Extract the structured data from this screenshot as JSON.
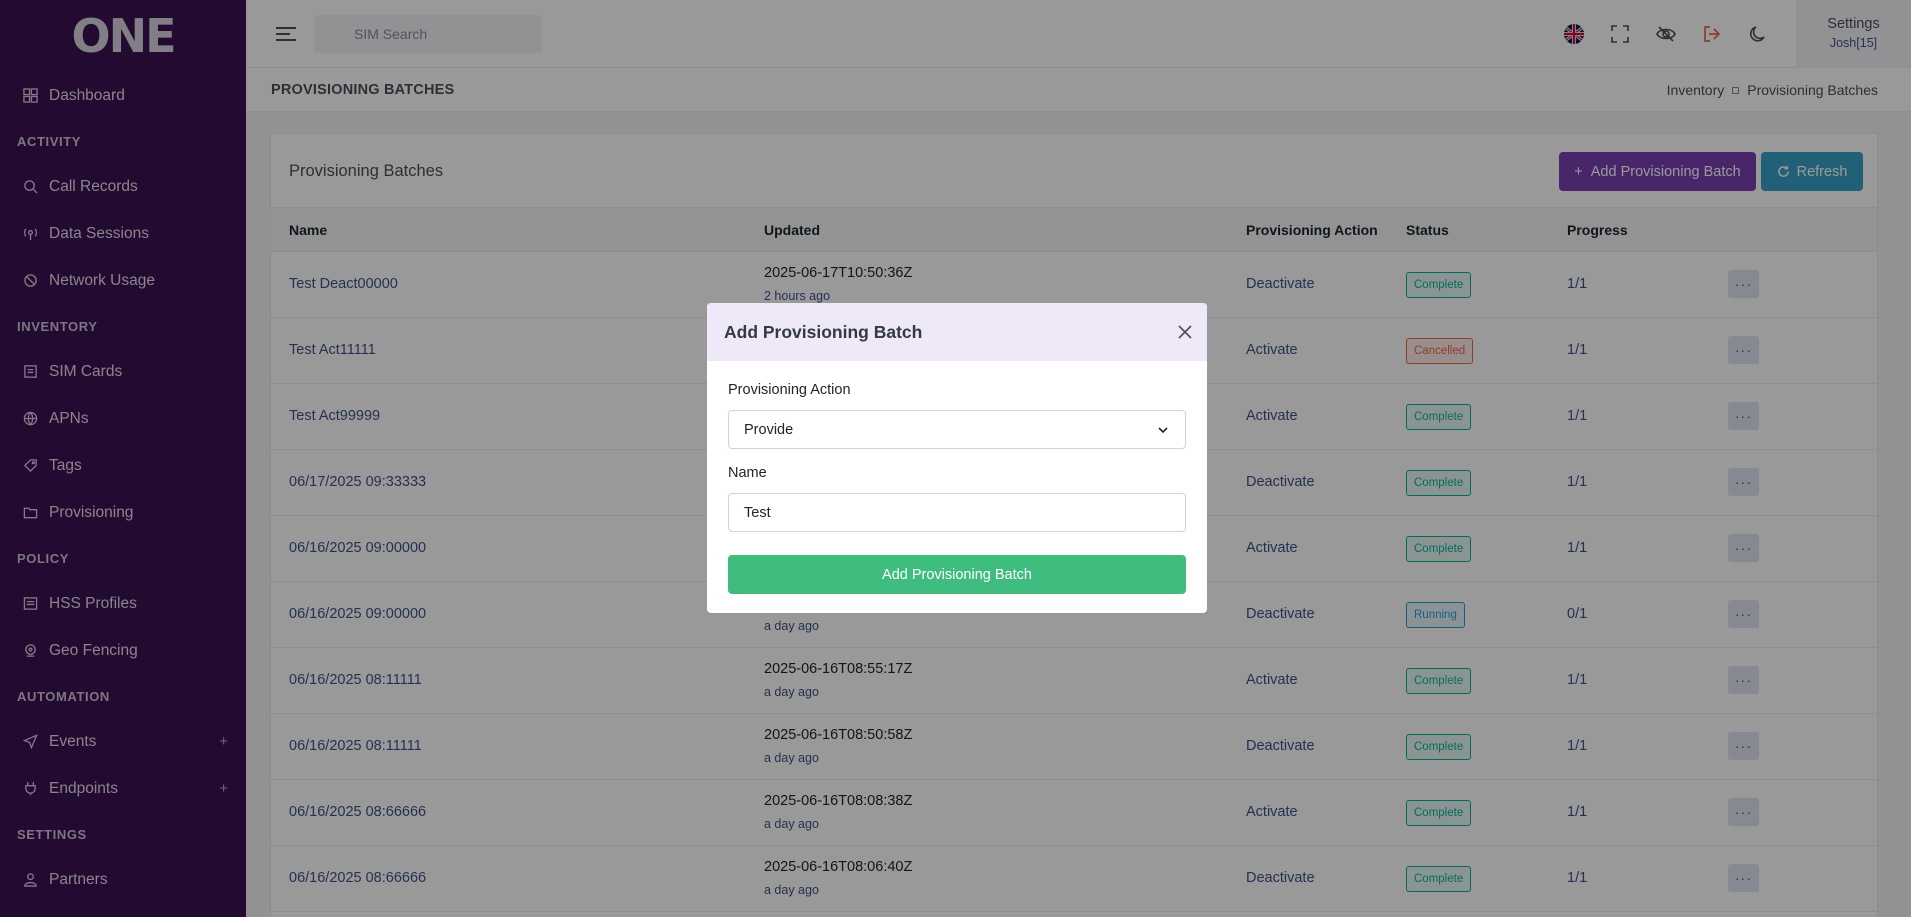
{
  "sidebar": {
    "logo": "ONE",
    "items": [
      {
        "type": "item",
        "label": "Dashboard",
        "icon": "dashboard-icon"
      },
      {
        "type": "section",
        "label": "ACTIVITY"
      },
      {
        "type": "item",
        "label": "Call Records",
        "icon": "search-phone-icon"
      },
      {
        "type": "item",
        "label": "Data Sessions",
        "icon": "antenna-icon"
      },
      {
        "type": "item",
        "label": "Network Usage",
        "icon": "no-signal-icon"
      },
      {
        "type": "section",
        "label": "INVENTORY"
      },
      {
        "type": "item",
        "label": "SIM Cards",
        "icon": "sim-icon"
      },
      {
        "type": "item",
        "label": "APNs",
        "icon": "globe-icon"
      },
      {
        "type": "item",
        "label": "Tags",
        "icon": "tag-icon"
      },
      {
        "type": "item",
        "label": "Provisioning",
        "icon": "folder-icon"
      },
      {
        "type": "section",
        "label": "POLICY"
      },
      {
        "type": "item",
        "label": "HSS Profiles",
        "icon": "list-icon"
      },
      {
        "type": "item",
        "label": "Geo Fencing",
        "icon": "pin-icon"
      },
      {
        "type": "section",
        "label": "AUTOMATION"
      },
      {
        "type": "item",
        "label": "Events",
        "icon": "send-icon",
        "expand": "+"
      },
      {
        "type": "item",
        "label": "Endpoints",
        "icon": "plug-icon",
        "expand": "+"
      },
      {
        "type": "section",
        "label": "SETTINGS"
      },
      {
        "type": "item",
        "label": "Partners",
        "icon": "users-icon"
      }
    ]
  },
  "topbar": {
    "search_placeholder": "SIM Search",
    "settings_label": "Settings",
    "user": "Josh[15]"
  },
  "page": {
    "title": "PROVISIONING BATCHES",
    "breadcrumb": [
      "Inventory",
      "Provisioning Batches"
    ]
  },
  "card": {
    "title": "Provisioning Batches",
    "add_button": "Add Provisioning Batch",
    "refresh_button": "Refresh"
  },
  "table": {
    "columns": [
      "Name",
      "Updated",
      "Provisioning Action",
      "Status",
      "Progress"
    ],
    "rows": [
      {
        "name": "Test Deact00000",
        "updated": "2025-06-17T10:50:36Z",
        "ago": "2 hours ago",
        "action": "Deactivate",
        "status": "Complete",
        "progress": "1/1"
      },
      {
        "name": "Test Act11111",
        "updated": "",
        "ago": "",
        "action": "Activate",
        "status": "Cancelled",
        "progress": "1/1"
      },
      {
        "name": "Test Act99999",
        "updated": "",
        "ago": "",
        "action": "Activate",
        "status": "Complete",
        "progress": "1/1"
      },
      {
        "name": "06/17/2025 09:33333",
        "updated": "",
        "ago": "",
        "action": "Deactivate",
        "status": "Complete",
        "progress": "1/1"
      },
      {
        "name": "06/16/2025 09:00000",
        "updated": "",
        "ago": "",
        "action": "Activate",
        "status": "Complete",
        "progress": "1/1"
      },
      {
        "name": "06/16/2025 09:00000",
        "updated": "",
        "ago": "a day ago",
        "action": "Deactivate",
        "status": "Running",
        "progress": "0/1"
      },
      {
        "name": "06/16/2025 08:11111",
        "updated": "2025-06-16T08:55:17Z",
        "ago": "a day ago",
        "action": "Activate",
        "status": "Complete",
        "progress": "1/1"
      },
      {
        "name": "06/16/2025 08:11111",
        "updated": "2025-06-16T08:50:58Z",
        "ago": "a day ago",
        "action": "Deactivate",
        "status": "Complete",
        "progress": "1/1"
      },
      {
        "name": "06/16/2025 08:66666",
        "updated": "2025-06-16T08:08:38Z",
        "ago": "a day ago",
        "action": "Activate",
        "status": "Complete",
        "progress": "1/1"
      },
      {
        "name": "06/16/2025 08:66666",
        "updated": "2025-06-16T08:06:40Z",
        "ago": "a day ago",
        "action": "Deactivate",
        "status": "Complete",
        "progress": "1/1"
      }
    ],
    "row_menu_label": "···"
  },
  "modal": {
    "title": "Add Provisioning Batch",
    "action_label": "Provisioning Action",
    "action_value": "Provide",
    "name_label": "Name",
    "name_value": "Test",
    "submit": "Add Provisioning Batch"
  },
  "colors": {
    "sidebar_bg": "#3a1250",
    "primary_button": "#7b3fb0",
    "refresh_button": "#3aa0c9",
    "submit_button": "#3ebd7e",
    "link": "#405189"
  }
}
